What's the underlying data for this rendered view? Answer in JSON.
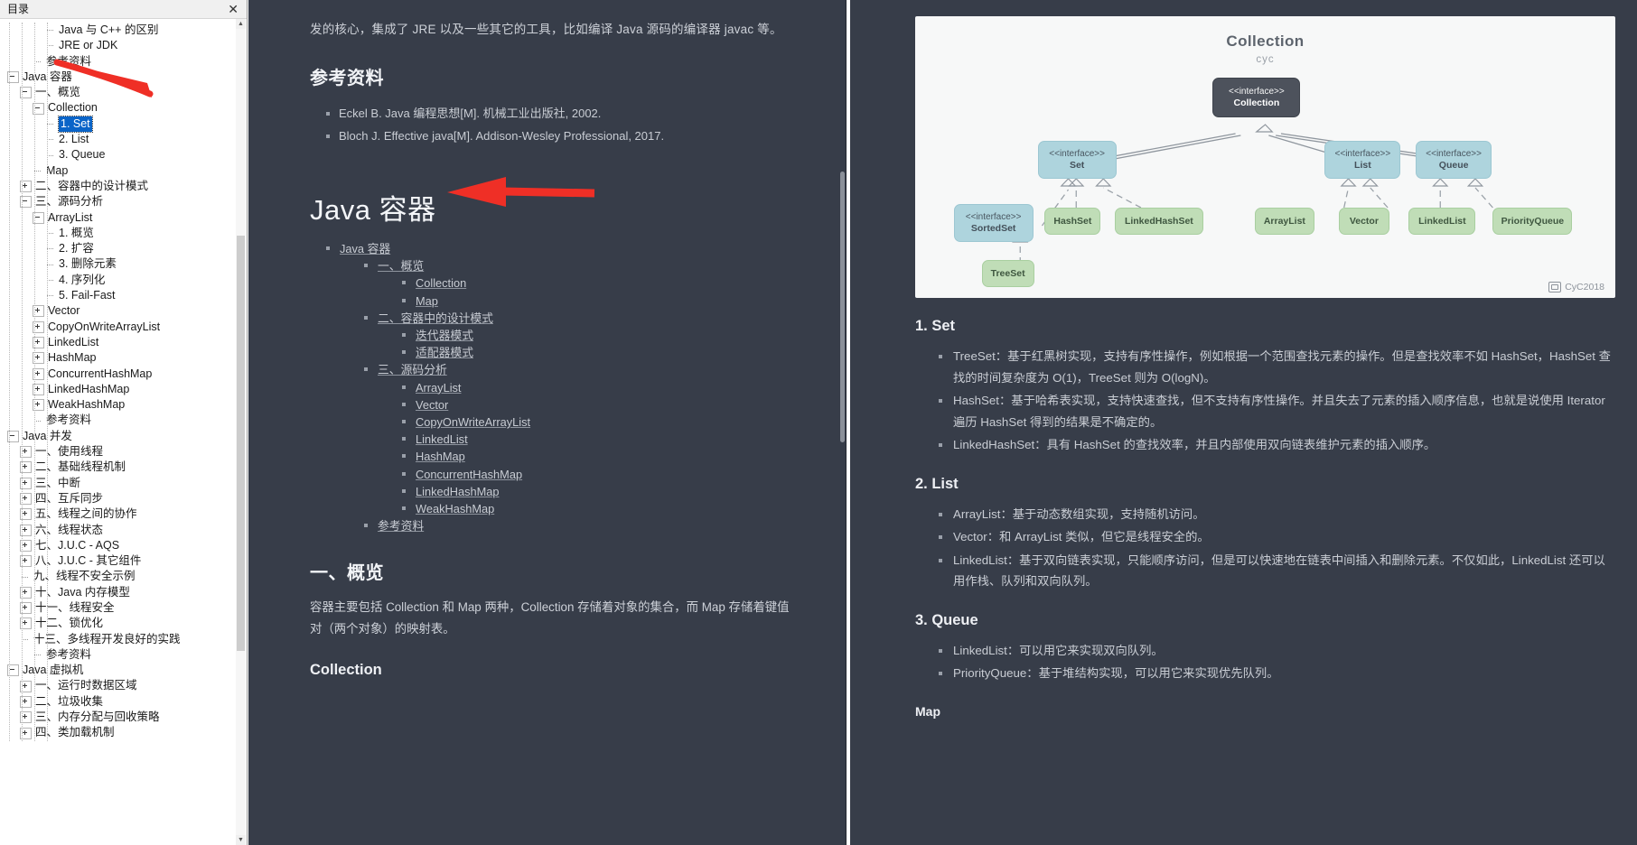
{
  "toc_window": {
    "title": "目录",
    "close_label": "✕",
    "items": [
      {
        "label": "Java 与 C++ 的区别",
        "depth": 3,
        "icon": "leaf"
      },
      {
        "label": "JRE or JDK",
        "depth": 3,
        "icon": "leaf"
      },
      {
        "label": "参考资料",
        "depth": 2,
        "icon": "leaf"
      },
      {
        "label": "Java 容器",
        "depth": 0,
        "icon": "minus"
      },
      {
        "label": "一、概览",
        "depth": 1,
        "icon": "minus"
      },
      {
        "label": "Collection",
        "depth": 2,
        "icon": "minus"
      },
      {
        "label": "1. Set",
        "depth": 3,
        "icon": "leaf",
        "selected": true
      },
      {
        "label": "2. List",
        "depth": 3,
        "icon": "leaf"
      },
      {
        "label": "3. Queue",
        "depth": 3,
        "icon": "leaf"
      },
      {
        "label": "Map",
        "depth": 2,
        "icon": "leaf"
      },
      {
        "label": "二、容器中的设计模式",
        "depth": 1,
        "icon": "plus"
      },
      {
        "label": "三、源码分析",
        "depth": 1,
        "icon": "minus"
      },
      {
        "label": "ArrayList",
        "depth": 2,
        "icon": "minus"
      },
      {
        "label": "1. 概览",
        "depth": 3,
        "icon": "leaf"
      },
      {
        "label": "2. 扩容",
        "depth": 3,
        "icon": "leaf"
      },
      {
        "label": "3. 删除元素",
        "depth": 3,
        "icon": "leaf"
      },
      {
        "label": "4. 序列化",
        "depth": 3,
        "icon": "leaf"
      },
      {
        "label": "5. Fail-Fast",
        "depth": 3,
        "icon": "leaf"
      },
      {
        "label": "Vector",
        "depth": 2,
        "icon": "plus"
      },
      {
        "label": "CopyOnWriteArrayList",
        "depth": 2,
        "icon": "plus"
      },
      {
        "label": "LinkedList",
        "depth": 2,
        "icon": "plus"
      },
      {
        "label": "HashMap",
        "depth": 2,
        "icon": "plus"
      },
      {
        "label": "ConcurrentHashMap",
        "depth": 2,
        "icon": "plus"
      },
      {
        "label": "LinkedHashMap",
        "depth": 2,
        "icon": "plus"
      },
      {
        "label": "WeakHashMap",
        "depth": 2,
        "icon": "plus"
      },
      {
        "label": "参考资料",
        "depth": 2,
        "icon": "leaf"
      },
      {
        "label": "Java 并发",
        "depth": 0,
        "icon": "minus"
      },
      {
        "label": "一、使用线程",
        "depth": 1,
        "icon": "plus"
      },
      {
        "label": "二、基础线程机制",
        "depth": 1,
        "icon": "plus"
      },
      {
        "label": "三、中断",
        "depth": 1,
        "icon": "plus"
      },
      {
        "label": "四、互斥同步",
        "depth": 1,
        "icon": "plus"
      },
      {
        "label": "五、线程之间的协作",
        "depth": 1,
        "icon": "plus"
      },
      {
        "label": "六、线程状态",
        "depth": 1,
        "icon": "plus"
      },
      {
        "label": "七、J.U.C - AQS",
        "depth": 1,
        "icon": "plus"
      },
      {
        "label": "八、J.U.C - 其它组件",
        "depth": 1,
        "icon": "plus"
      },
      {
        "label": "九、线程不安全示例",
        "depth": 1,
        "icon": "leaf"
      },
      {
        "label": "十、Java 内存模型",
        "depth": 1,
        "icon": "plus"
      },
      {
        "label": "十一、线程安全",
        "depth": 1,
        "icon": "plus"
      },
      {
        "label": "十二、锁优化",
        "depth": 1,
        "icon": "plus"
      },
      {
        "label": "十三、多线程开发良好的实践",
        "depth": 1,
        "icon": "leaf"
      },
      {
        "label": "参考资料",
        "depth": 2,
        "icon": "leaf"
      },
      {
        "label": "Java 虚拟机",
        "depth": 0,
        "icon": "minus"
      },
      {
        "label": "一、运行时数据区域",
        "depth": 1,
        "icon": "plus"
      },
      {
        "label": "二、垃圾收集",
        "depth": 1,
        "icon": "plus"
      },
      {
        "label": "三、内存分配与回收策略",
        "depth": 1,
        "icon": "plus"
      },
      {
        "label": "四、类加载机制",
        "depth": 1,
        "icon": "plus"
      }
    ]
  },
  "middle": {
    "tail_paragraph": "发的核心，集成了 JRE 以及一些其它的工具，比如编译 Java 源码的编译器 javac 等。",
    "refs_heading": "参考资料",
    "refs": [
      "Eckel B. Java 编程思想[M]. 机械工业出版社, 2002.",
      "Bloch J. Effective java[M]. Addison-Wesley Professional, 2017."
    ],
    "big_title": "Java 容器",
    "toc": [
      {
        "label": "Java 容器",
        "depth": 0
      },
      {
        "label": "一、概览",
        "depth": 1
      },
      {
        "label": "Collection",
        "depth": 2
      },
      {
        "label": "Map",
        "depth": 2
      },
      {
        "label": "二、容器中的设计模式",
        "depth": 1
      },
      {
        "label": "迭代器模式",
        "depth": 2
      },
      {
        "label": "适配器模式",
        "depth": 2
      },
      {
        "label": "三、源码分析",
        "depth": 1
      },
      {
        "label": "ArrayList",
        "depth": 2
      },
      {
        "label": "Vector",
        "depth": 2
      },
      {
        "label": "CopyOnWriteArrayList",
        "depth": 2
      },
      {
        "label": "LinkedList",
        "depth": 2
      },
      {
        "label": "HashMap",
        "depth": 2
      },
      {
        "label": "ConcurrentHashMap",
        "depth": 2
      },
      {
        "label": "LinkedHashMap",
        "depth": 2
      },
      {
        "label": "WeakHashMap",
        "depth": 2
      },
      {
        "label": "参考资料",
        "depth": 1
      }
    ],
    "section_heading": "一、概览",
    "section_paragraph": "容器主要包括 Collection 和 Map 两种，Collection 存储着对象的集合，而 Map 存储着键值对（两个对象）的映射表。",
    "subsection_heading": "Collection"
  },
  "right": {
    "figure": {
      "title": "Collection",
      "subtitle": "cyc",
      "watermark": "CyC2018",
      "nodes": [
        {
          "stereotype": "<<interface>>",
          "name": "Collection",
          "style": "dark"
        },
        {
          "stereotype": "<<interface>>",
          "name": "Set",
          "style": "blue"
        },
        {
          "stereotype": "<<interface>>",
          "name": "List",
          "style": "blue"
        },
        {
          "stereotype": "<<interface>>",
          "name": "Queue",
          "style": "blue"
        },
        {
          "stereotype": "<<interface>>",
          "name": "SortedSet",
          "style": "blue"
        },
        {
          "stereotype": "",
          "name": "HashSet",
          "style": "green"
        },
        {
          "stereotype": "",
          "name": "LinkedHashSet",
          "style": "green"
        },
        {
          "stereotype": "",
          "name": "ArrayList",
          "style": "green"
        },
        {
          "stereotype": "",
          "name": "Vector",
          "style": "green"
        },
        {
          "stereotype": "",
          "name": "LinkedList",
          "style": "green"
        },
        {
          "stereotype": "",
          "name": "PriorityQueue",
          "style": "green"
        },
        {
          "stereotype": "",
          "name": "TreeSet",
          "style": "green"
        }
      ]
    },
    "sections": [
      {
        "heading": "1. Set",
        "items": [
          "TreeSet：基于红黑树实现，支持有序性操作，例如根据一个范围查找元素的操作。但是查找效率不如 HashSet，HashSet 查找的时间复杂度为 O(1)，TreeSet 则为 O(logN)。",
          "HashSet：基于哈希表实现，支持快速查找，但不支持有序性操作。并且失去了元素的插入顺序信息，也就是说使用 Iterator 遍历 HashSet 得到的结果是不确定的。",
          "LinkedHashSet：具有 HashSet 的查找效率，并且内部使用双向链表维护元素的插入顺序。"
        ]
      },
      {
        "heading": "2. List",
        "items": [
          "ArrayList：基于动态数组实现，支持随机访问。",
          "Vector：和 ArrayList 类似，但它是线程安全的。",
          "LinkedList：基于双向链表实现，只能顺序访问，但是可以快速地在链表中间插入和删除元素。不仅如此，LinkedList 还可以用作栈、队列和双向队列。"
        ]
      },
      {
        "heading": "3. Queue",
        "items": [
          "LinkedList：可以用它来实现双向队列。",
          "PriorityQueue：基于堆结构实现，可以用它来实现优先队列。"
        ]
      }
    ],
    "map_heading": "Map"
  },
  "annotations": {
    "arrow_color": "#ef2f26",
    "arrow1_target": "Java 容器",
    "arrow2_target": "Java 容器"
  }
}
